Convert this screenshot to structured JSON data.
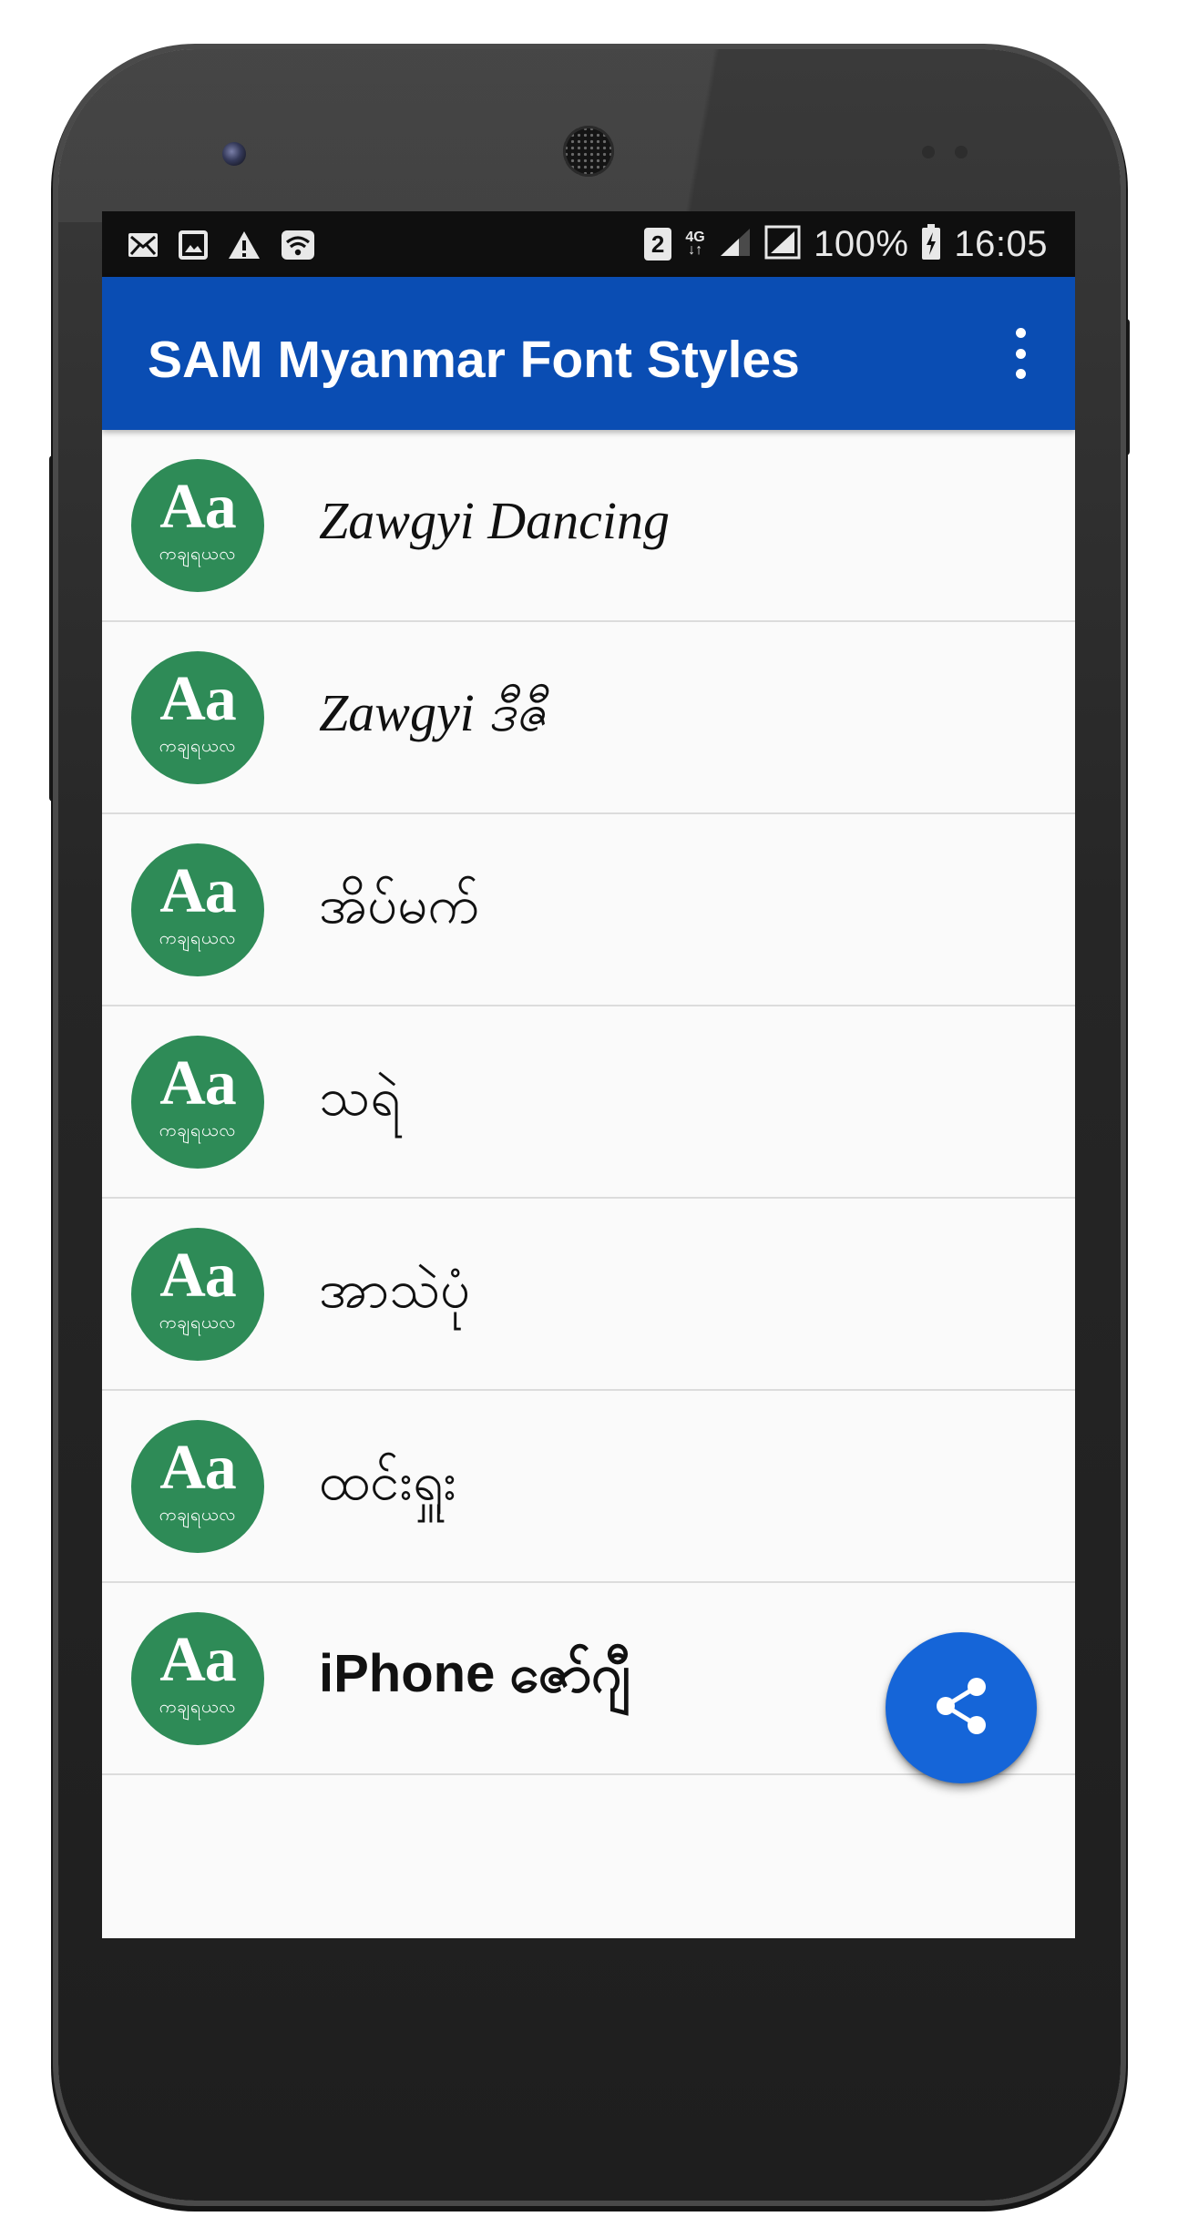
{
  "status_bar": {
    "sim_slot": "2",
    "network_top": "4G",
    "network_bottom": "↓↑",
    "battery": "100%",
    "time": "16:05"
  },
  "app_bar": {
    "title": "SAM Myanmar Font Styles"
  },
  "font_items": [
    {
      "icon_title": "Aa",
      "icon_subtitle": "ကချရယလ",
      "label": "Zawgyi Dancing"
    },
    {
      "icon_title": "Aa",
      "icon_subtitle": "ကချရယလ",
      "label": "Zawgyi ဒီဇီ"
    },
    {
      "icon_title": "Aa",
      "icon_subtitle": "ကချရယလ",
      "label": "အိပ်မက်"
    },
    {
      "icon_title": "Aa",
      "icon_subtitle": "ကချရယလ",
      "label": "သရဲ"
    },
    {
      "icon_title": "Aa",
      "icon_subtitle": "ကချရယလ",
      "label": "အာသဲပုံ"
    },
    {
      "icon_title": "Aa",
      "icon_subtitle": "ကချရယလ",
      "label": "ထင်းရှူး"
    },
    {
      "icon_title": "Aa",
      "icon_subtitle": "ကချရယလ",
      "label": "iPhone ဇော်ဂျီ"
    }
  ],
  "colors": {
    "app_bar": "#0a4db3",
    "fab": "#1565d8",
    "icon_bg": "#2e8b57"
  },
  "icons": {
    "overflow": "more-vert-icon",
    "fab": "share-icon",
    "status_left": [
      "email-icon",
      "image-icon",
      "warning-icon",
      "wifi-icon"
    ],
    "status_right": [
      "signal-icon",
      "signal-icon",
      "battery-charging-icon"
    ]
  }
}
